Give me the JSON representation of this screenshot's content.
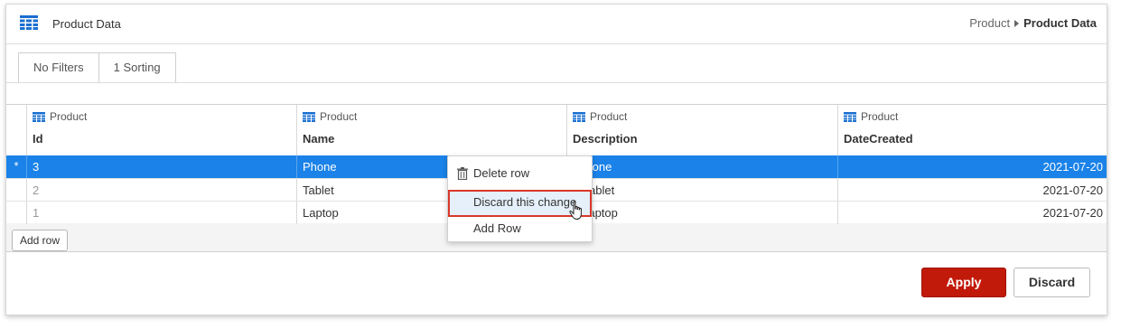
{
  "header": {
    "title": "Product Data",
    "icon": "grid-icon",
    "breadcrumb": [
      "Product",
      "Product Data"
    ]
  },
  "tabs": [
    {
      "label": "No Filters"
    },
    {
      "label": "1 Sorting"
    }
  ],
  "grid": {
    "columns": [
      {
        "entity": "Product",
        "field": "Id"
      },
      {
        "entity": "Product",
        "field": "Name"
      },
      {
        "entity": "Product",
        "field": "Description"
      },
      {
        "entity": "Product",
        "field": "DateCreated"
      }
    ],
    "rows": [
      {
        "marker": "*",
        "id": "3",
        "name": "Phone",
        "description": "t phone",
        "date": "2021-07-20",
        "selected": true
      },
      {
        "marker": "",
        "id": "2",
        "name": "Tablet",
        "description": "at tablet",
        "date": "2021-07-20",
        "selected": false
      },
      {
        "marker": "",
        "id": "1",
        "name": "Laptop",
        "description": "at laptop",
        "date": "2021-07-20",
        "selected": false
      }
    ],
    "add_row_label": "Add row"
  },
  "context_menu": {
    "items": [
      {
        "label": "Delete row",
        "icon": "trash-icon"
      },
      {
        "label": "Discard this change",
        "highlighted": true
      },
      {
        "label": "Add Row"
      }
    ]
  },
  "footer": {
    "apply_label": "Apply",
    "discard_label": "Discard"
  },
  "colors": {
    "selection": "#1a82e8",
    "apply": "#c21a0a",
    "highlight_border": "#d9372a",
    "icon_blue": "#1a6fd0"
  }
}
